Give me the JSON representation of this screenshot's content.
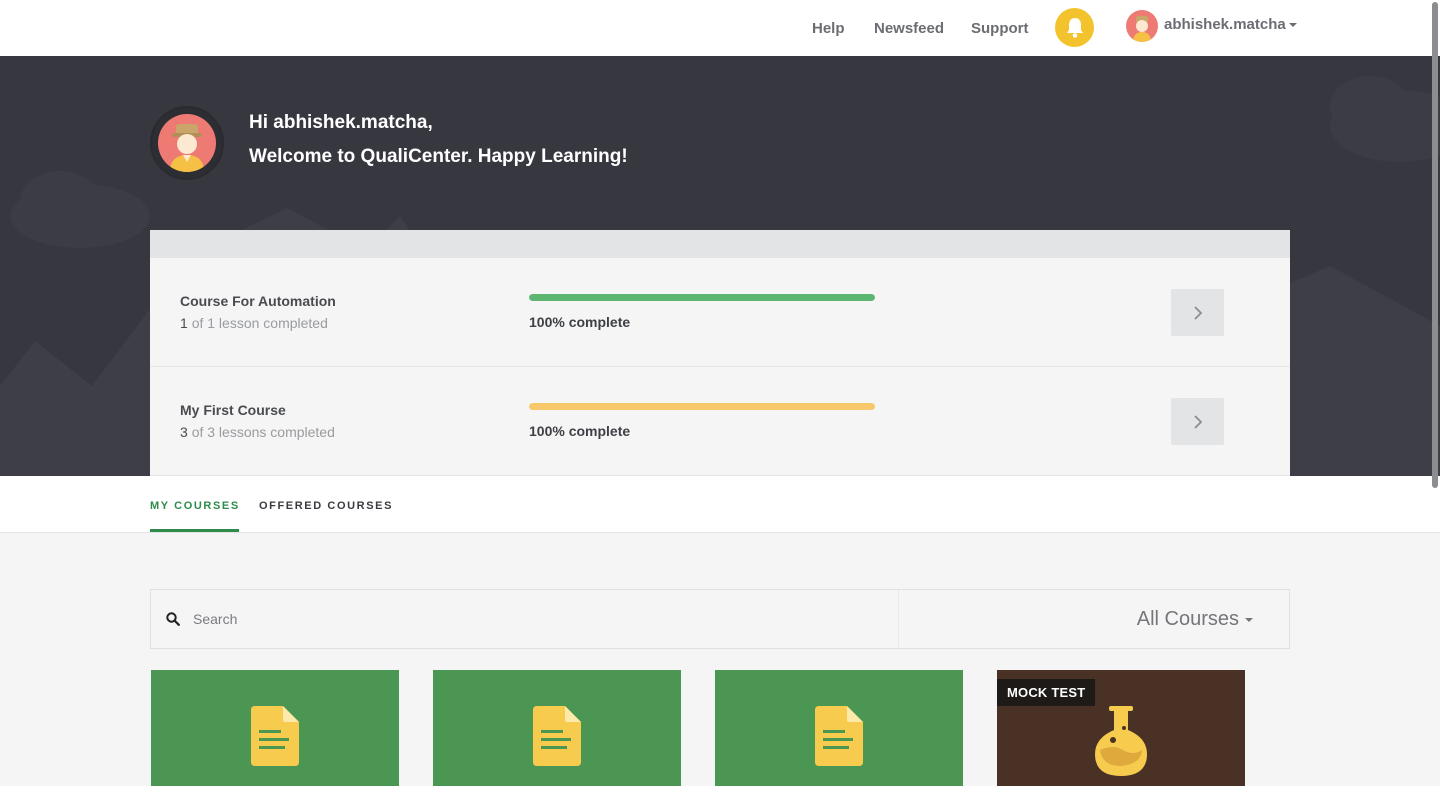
{
  "nav": {
    "links": [
      "Help",
      "Newsfeed",
      "Support"
    ],
    "username": "abhishek.matcha",
    "bell_icon": "bell-icon"
  },
  "hero": {
    "greeting": "Hi abhishek.matcha,",
    "welcome": "Welcome to QualiCenter. Happy Learning!"
  },
  "courses": [
    {
      "title": "Course For Automation",
      "completed": "1",
      "progress_text": "of 1 lesson completed",
      "progress": 1.0,
      "progress_label": "100% complete",
      "bar_color": "#5cb672"
    },
    {
      "title": "My First Course",
      "completed": "3",
      "progress_text": "of 3 lessons completed",
      "progress": 1.0,
      "progress_label": "100% complete",
      "bar_color": "#f8c96b"
    }
  ],
  "tabs": {
    "my_courses": "MY COURSES",
    "offered_courses": "OFFERED COURSES"
  },
  "search": {
    "placeholder": "Search",
    "filter_label": "All Courses"
  },
  "cards": [
    {
      "icon": "document-icon",
      "color": "#4a9652"
    },
    {
      "icon": "document-icon",
      "color": "#4a9652"
    },
    {
      "icon": "document-icon",
      "color": "#4a9652"
    },
    {
      "icon": "flask-icon",
      "color": "#4a3126",
      "badge": "MOCK TEST"
    }
  ],
  "colors": {
    "accent_green": "#2e8b4a",
    "hero_bg": "#373740",
    "bell_yellow": "#f3c32e"
  }
}
